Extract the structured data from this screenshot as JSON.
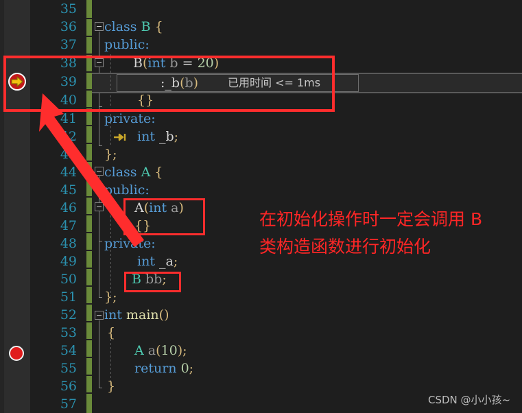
{
  "editor": {
    "background": "#1e1e1e",
    "gutter_background": "#2d2d2d",
    "line_number_color": "#2b91af",
    "change_bar_color": "#6a8a3a",
    "first_visible_line": 35,
    "last_visible_line": 57,
    "lines": [
      {
        "num": "35",
        "code": ""
      },
      {
        "num": "36",
        "code": "class B {"
      },
      {
        "num": "37",
        "code": " public:"
      },
      {
        "num": "38",
        "code": "    B(int b = 20)"
      },
      {
        "num": "39",
        "code": "        :_b(b)"
      },
      {
        "num": "40",
        "code": "    {}"
      },
      {
        "num": "41",
        "code": " private:"
      },
      {
        "num": "42",
        "code": "    int _b;"
      },
      {
        "num": "43",
        "code": " };"
      },
      {
        "num": "44",
        "code": "class A {"
      },
      {
        "num": "45",
        "code": " public:"
      },
      {
        "num": "46",
        "code": "    A(int a)"
      },
      {
        "num": "47",
        "code": "    {}"
      },
      {
        "num": "48",
        "code": " private:"
      },
      {
        "num": "49",
        "code": "    int _a;"
      },
      {
        "num": "50",
        "code": "    B bb;"
      },
      {
        "num": "51",
        "code": " };"
      },
      {
        "num": "52",
        "code": "int main()"
      },
      {
        "num": "53",
        "code": " {"
      },
      {
        "num": "54",
        "code": "    A a(10);"
      },
      {
        "num": "55",
        "code": "    return 0;"
      },
      {
        "num": "56",
        "code": " }"
      },
      {
        "num": "57",
        "code": ""
      }
    ]
  },
  "tokens": {
    "kw_class": "class",
    "kw_public": "public:",
    "kw_private": "private:",
    "kw_int": "int",
    "kw_return": "return",
    "name_B": "B",
    "name_A": "A",
    "brace_open": "{",
    "brace_close": "};",
    "brace_close_plain": "}",
    "brace_empty": "{}",
    "ctor_B_sig": "B(int b = 20)",
    "ctor_B_init": ":_b(b)",
    "member_b": "int _b;",
    "ctor_A_sig": "A(int a)",
    "member_a": "int _a;",
    "member_bb": "B bb;",
    "main_sig": "int main()",
    "stmt_a": "A a(10);",
    "stmt_return": "return 0;"
  },
  "debug": {
    "datatip_text": "已用时间 <= 1ms",
    "execution_line": "39",
    "breakpoint_line": "54",
    "execution_marker_name": "current-statement-arrow",
    "breakpoint_marker_name": "breakpoint-dot"
  },
  "annotation": {
    "text_line1": "在初始化操作时一定会调用 B",
    "text_line2": "类构造函数进行初始化",
    "color": "#ff2626",
    "highlight_boxes": [
      {
        "label": "ctor-B-region",
        "lines": "38-40"
      },
      {
        "label": "ctor-A-region",
        "lines": "46-47"
      },
      {
        "label": "member-bb-region",
        "lines": "50"
      }
    ]
  },
  "watermark": {
    "text": "CSDN @小小孩~"
  }
}
